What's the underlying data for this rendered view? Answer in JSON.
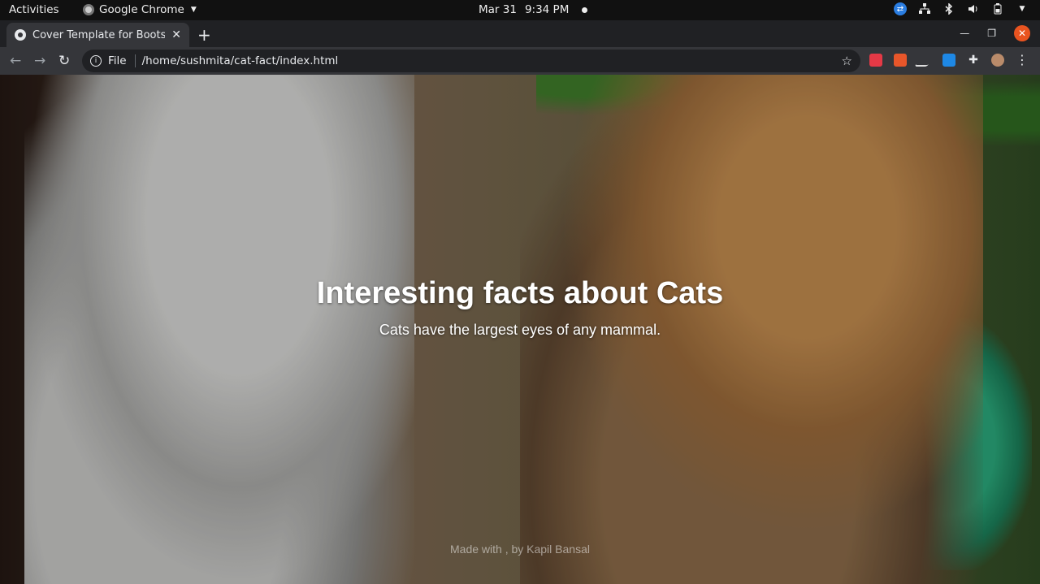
{
  "system": {
    "activities": "Activities",
    "app_name": "Google Chrome",
    "date": "Mar 31",
    "time": "9:34 PM"
  },
  "browser": {
    "tab_title": "Cover Template for Boots",
    "address_prefix": "File",
    "address": "/home/sushmita/cat-fact/index.html"
  },
  "page": {
    "heading": "Interesting facts about Cats",
    "fact": "Cats have the largest eyes of any mammal.",
    "footer": "Made with , by Kapil Bansal"
  },
  "icons": {
    "tray": [
      "teamviewer-icon",
      "network-icon",
      "bluetooth-icon",
      "volume-icon",
      "battery-icon",
      "system-menu-icon"
    ],
    "extensions": [
      "extension-red-icon",
      "extension-orange-icon",
      "extension-pen-icon",
      "extension-blue-icon",
      "extensions-puzzle-icon",
      "profile-avatar",
      "chrome-menu-icon"
    ]
  },
  "colors": {
    "close_button": "#e95420",
    "tab_active": "#35363a",
    "tabstrip": "#202124"
  }
}
